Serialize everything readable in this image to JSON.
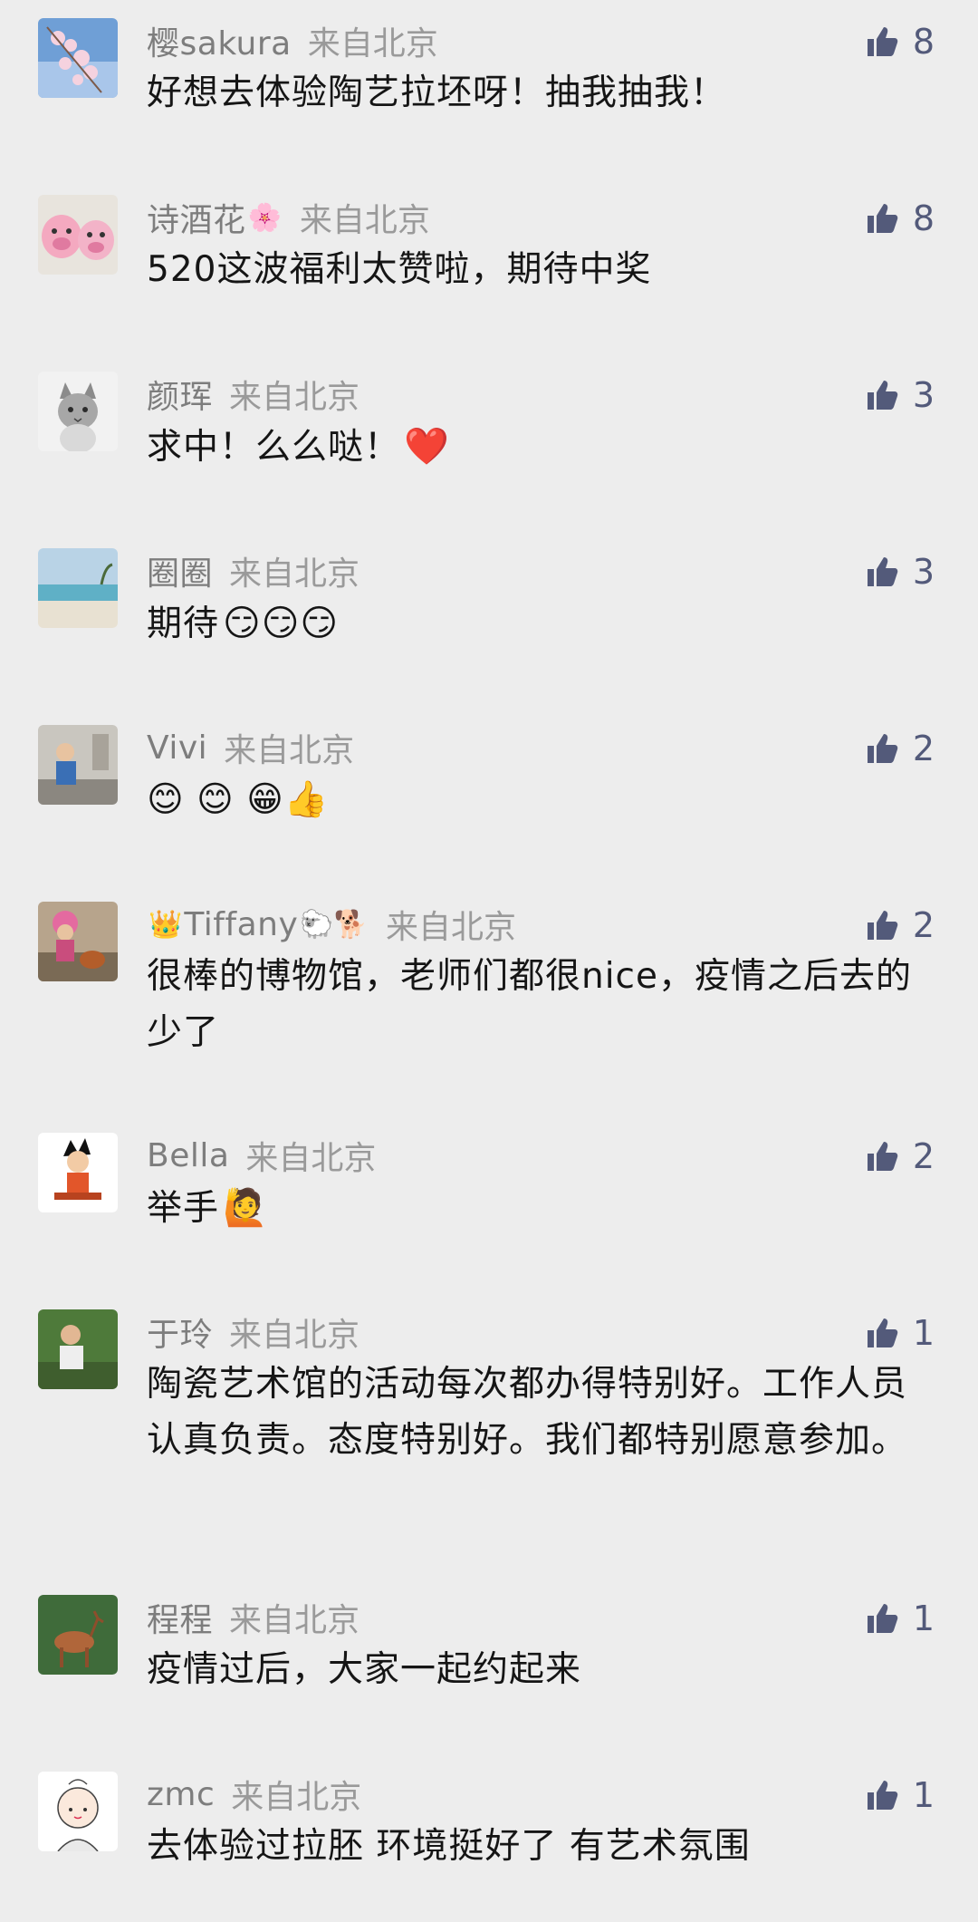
{
  "location_label": "来自北京",
  "comments": [
    {
      "nickname": "樱sakura",
      "text": "好想去体验陶艺拉坯呀！抽我抽我！",
      "likes": "8",
      "avatar": "cherry-blossom-avatar"
    },
    {
      "nickname": "诗酒花",
      "nick_suffix": "🌸",
      "text": "520这波福利太赞啦，期待中奖",
      "likes": "8",
      "avatar": "pink-pigs-avatar"
    },
    {
      "nickname": "颜珲",
      "text": "求中！么么哒！",
      "text_emoji": "❤️",
      "likes": "3",
      "avatar": "cat-avatar"
    },
    {
      "nickname": "圈圈",
      "text": "期待",
      "text_emoji": "😏😏😏",
      "likes": "3",
      "avatar": "beach-avatar"
    },
    {
      "nickname": "Vivi",
      "text": "😊 😊 😁👍",
      "likes": "2",
      "avatar": "child-photo-avatar"
    },
    {
      "nickname": "Tiffany",
      "nick_prefix": "👑",
      "nick_suffix": "🐑🐕",
      "text": "很棒的博物馆，老师们都很nice，疫情之后去的少了",
      "likes": "2",
      "avatar": "pink-hat-avatar"
    },
    {
      "nickname": "Bella",
      "text": "举手",
      "text_emoji": "🙋",
      "likes": "2",
      "avatar": "cartoon-avatar"
    },
    {
      "nickname": "于玲",
      "text": "陶瓷艺术馆的活动每次都办得特别好。工作人员认真负责。态度特别好。我们都特别愿意参加。",
      "likes": "1",
      "avatar": "boy-photo-avatar"
    },
    {
      "nickname": "程程",
      "text": "疫情过后，大家一起约起来",
      "likes": "1",
      "avatar": "deer-avatar"
    },
    {
      "nickname": "zmc",
      "text": "去体验过拉胚 环境挺好了 有艺术氛围",
      "likes": "1",
      "avatar": "girl-drawing-avatar"
    }
  ],
  "colors": {
    "background": "#ededed",
    "like_icon": "#535a7a",
    "nickname": "#7d7d7d"
  }
}
